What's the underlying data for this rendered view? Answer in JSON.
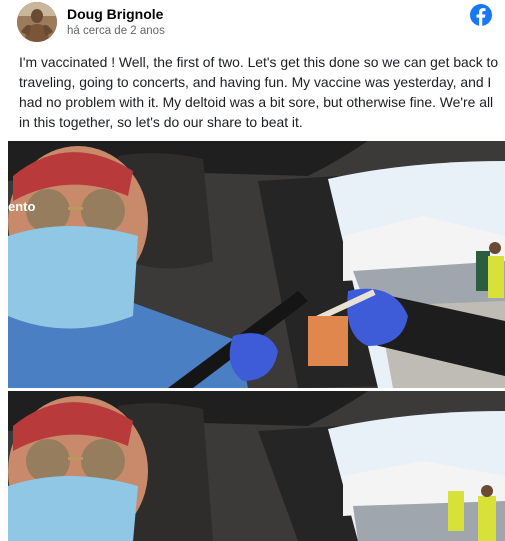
{
  "post": {
    "author": "Doug Brignole",
    "timestamp": "há cerca de 2 anos",
    "text": "I'm vaccinated ! Well, the first of two. Let's get this done so we can get back to traveling, going to concerts, and having fun. My vaccine was yesterday, and I had no problem with it. My deltoid was a bit sore, but otherwise fine. We're all in this together, so let's do our share to beat it.",
    "platform_icon": "facebook-icon",
    "avatar_icon": "profile-photo",
    "photos": [
      {
        "overlay_text": "ento"
      },
      {
        "overlay_text": ""
      }
    ]
  },
  "colors": {
    "facebook_blue": "#1877f2",
    "author_text": "#050505",
    "meta_text": "#65676b",
    "body_text": "#1c1e21"
  }
}
